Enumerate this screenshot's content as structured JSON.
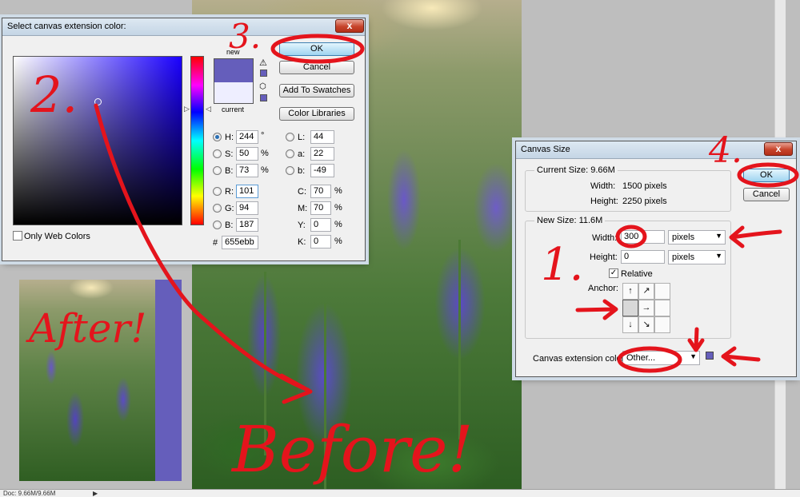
{
  "color_picker": {
    "title": "Select canvas extension color:",
    "close_label": "x",
    "new_label": "new",
    "current_label": "current",
    "ok_label": "OK",
    "cancel_label": "Cancel",
    "add_to_swatches_label": "Add To Swatches",
    "color_libraries_label": "Color Libraries",
    "only_web_colors_label": "Only Web Colors",
    "hsb": {
      "h": {
        "label": "H:",
        "value": "244",
        "unit": "°"
      },
      "s": {
        "label": "S:",
        "value": "50",
        "unit": "%"
      },
      "b": {
        "label": "B:",
        "value": "73",
        "unit": "%"
      }
    },
    "rgb": {
      "r": {
        "label": "R:",
        "value": "101"
      },
      "g": {
        "label": "G:",
        "value": "94"
      },
      "b": {
        "label": "B:",
        "value": "187"
      }
    },
    "lab": {
      "l": {
        "label": "L:",
        "value": "44"
      },
      "a": {
        "label": "a:",
        "value": "22"
      },
      "b": {
        "label": "b:",
        "value": "-49"
      }
    },
    "cmyk": {
      "c": {
        "label": "C:",
        "value": "70",
        "unit": "%"
      },
      "m": {
        "label": "M:",
        "value": "70",
        "unit": "%"
      },
      "y": {
        "label": "Y:",
        "value": "0",
        "unit": "%"
      },
      "k": {
        "label": "K:",
        "value": "0",
        "unit": "%"
      }
    },
    "hex_label": "#",
    "hex_value": "655ebb",
    "selected_color": "#655ebb",
    "current_color": "#eeeeff"
  },
  "canvas_size": {
    "title": "Canvas Size",
    "close_label": "x",
    "current_size_label": "Current Size: 9.66M",
    "current_width_label": "Width:",
    "current_width_value": "1500 pixels",
    "current_height_label": "Height:",
    "current_height_value": "2250 pixels",
    "new_size_label": "New Size: 11.6M",
    "width_label": "Width:",
    "width_value": "300",
    "width_unit": "pixels",
    "height_label": "Height:",
    "height_value": "0",
    "height_unit": "pixels",
    "relative_label": "Relative",
    "relative_checked": true,
    "anchor_label": "Anchor:",
    "anchor_arrows": [
      "↑",
      "↗",
      "",
      "",
      "→",
      "",
      "↓",
      "↘",
      ""
    ],
    "extension_color_label": "Canvas extension color:",
    "extension_color_value": "Other...",
    "ok_label": "OK",
    "cancel_label": "Cancel"
  },
  "annotations": {
    "step1": "1.",
    "step2": "2.",
    "step3": "3.",
    "step4": "4.",
    "after": "After!",
    "before": "Before!"
  },
  "statusbar": {
    "doc_info": "Doc: 9.66M/9.66M"
  },
  "colors": {
    "annotation_red": "#e4141c",
    "extension_color": "#655ebb"
  }
}
